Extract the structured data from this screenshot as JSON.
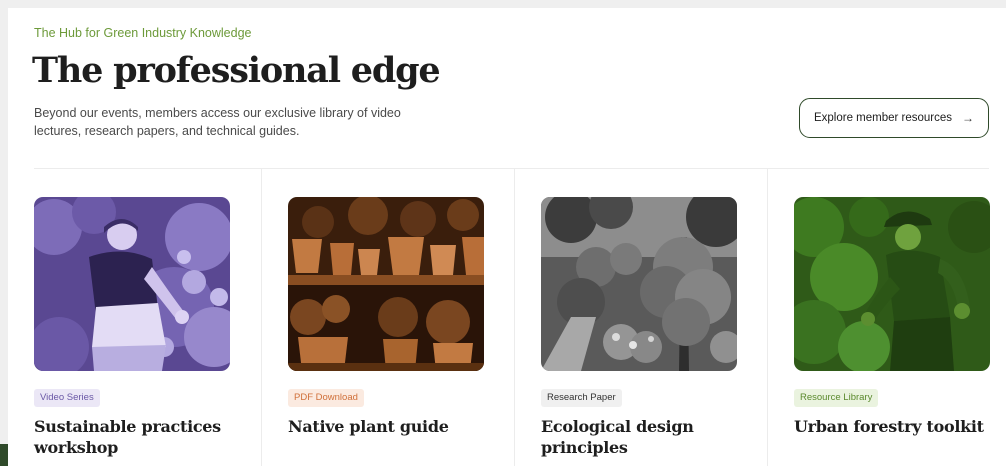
{
  "header": {
    "eyebrow": "The Hub for Green Industry Knowledge",
    "title": "The professional edge",
    "description": "Beyond our events, members access our exclusive library of video lectures, research papers, and technical guides.",
    "cta_label": "Explore member resources",
    "cta_icon": "arrow-right-icon"
  },
  "cards": [
    {
      "badge": "Video Series",
      "title": "Sustainable practices workshop",
      "badge_bg": "#ebe7f6",
      "badge_color": "#6a58a6",
      "tint": "#6450a0"
    },
    {
      "badge": "PDF Download",
      "title": "Native plant guide",
      "badge_bg": "#fbeae0",
      "badge_color": "#d0703a",
      "tint": "#8a4a1e"
    },
    {
      "badge": "Research Paper",
      "title": "Ecological design principles",
      "badge_bg": "#f0f0f0",
      "badge_color": "#333333",
      "tint": "#555555"
    },
    {
      "badge": "Resource Library",
      "title": "Urban forestry toolkit",
      "badge_bg": "#eaf3df",
      "badge_color": "#5b8a2e",
      "tint": "#3f6f1f"
    }
  ],
  "colors": {
    "accent": "#6d9a3a",
    "dark_green": "#2f4a2a",
    "heading": "#1e1e1e"
  }
}
